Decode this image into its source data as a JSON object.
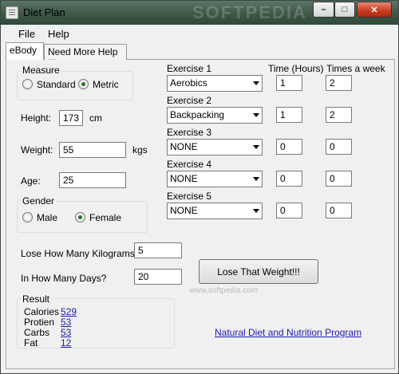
{
  "window": {
    "title": "Diet Plan",
    "watermark": "SOFTPEDIA"
  },
  "menu": {
    "file": "File",
    "help": "Help"
  },
  "tabs": [
    "eBody",
    "Need More Help !!!"
  ],
  "measure": {
    "title": "Measure",
    "options": [
      "Standard",
      "Metric"
    ],
    "selected": "Metric"
  },
  "height": {
    "label": "Height:",
    "value": "173",
    "unit": "cm"
  },
  "weight": {
    "label": "Weight:",
    "value": "55",
    "unit": "kgs"
  },
  "age": {
    "label": "Age:",
    "value": "25"
  },
  "gender": {
    "title": "Gender",
    "options": [
      "Male",
      "Female"
    ],
    "selected": "Female"
  },
  "exercise_headers": {
    "time": "Time (Hours)",
    "times_week": "Times a week"
  },
  "exercises": [
    {
      "label": "Exercise 1",
      "activity": "Aerobics",
      "time": "1",
      "times": "2"
    },
    {
      "label": "Exercise 2",
      "activity": "Backpacking",
      "time": "1",
      "times": "2"
    },
    {
      "label": "Exercise 3",
      "activity": "NONE",
      "time": "0",
      "times": "0"
    },
    {
      "label": "Exercise 4",
      "activity": "NONE",
      "time": "0",
      "times": "0"
    },
    {
      "label": "Exercise 5",
      "activity": "NONE",
      "time": "0",
      "times": "0"
    }
  ],
  "goal": {
    "lose_label": "Lose How Many Kilograms?",
    "lose_value": "5",
    "days_label": "In How Many Days?",
    "days_value": "20"
  },
  "action": {
    "button_label": "Lose That Weight!!!"
  },
  "result": {
    "title": "Result",
    "rows": [
      {
        "label": "Calories",
        "value": "529"
      },
      {
        "label": "Protien",
        "value": "53"
      },
      {
        "label": "Carbs",
        "value": "53"
      },
      {
        "label": "Fat",
        "value": "12"
      }
    ]
  },
  "footer_link": "Natural Diet and Nutrition Program",
  "watermark_small": "www.softpedia.com"
}
